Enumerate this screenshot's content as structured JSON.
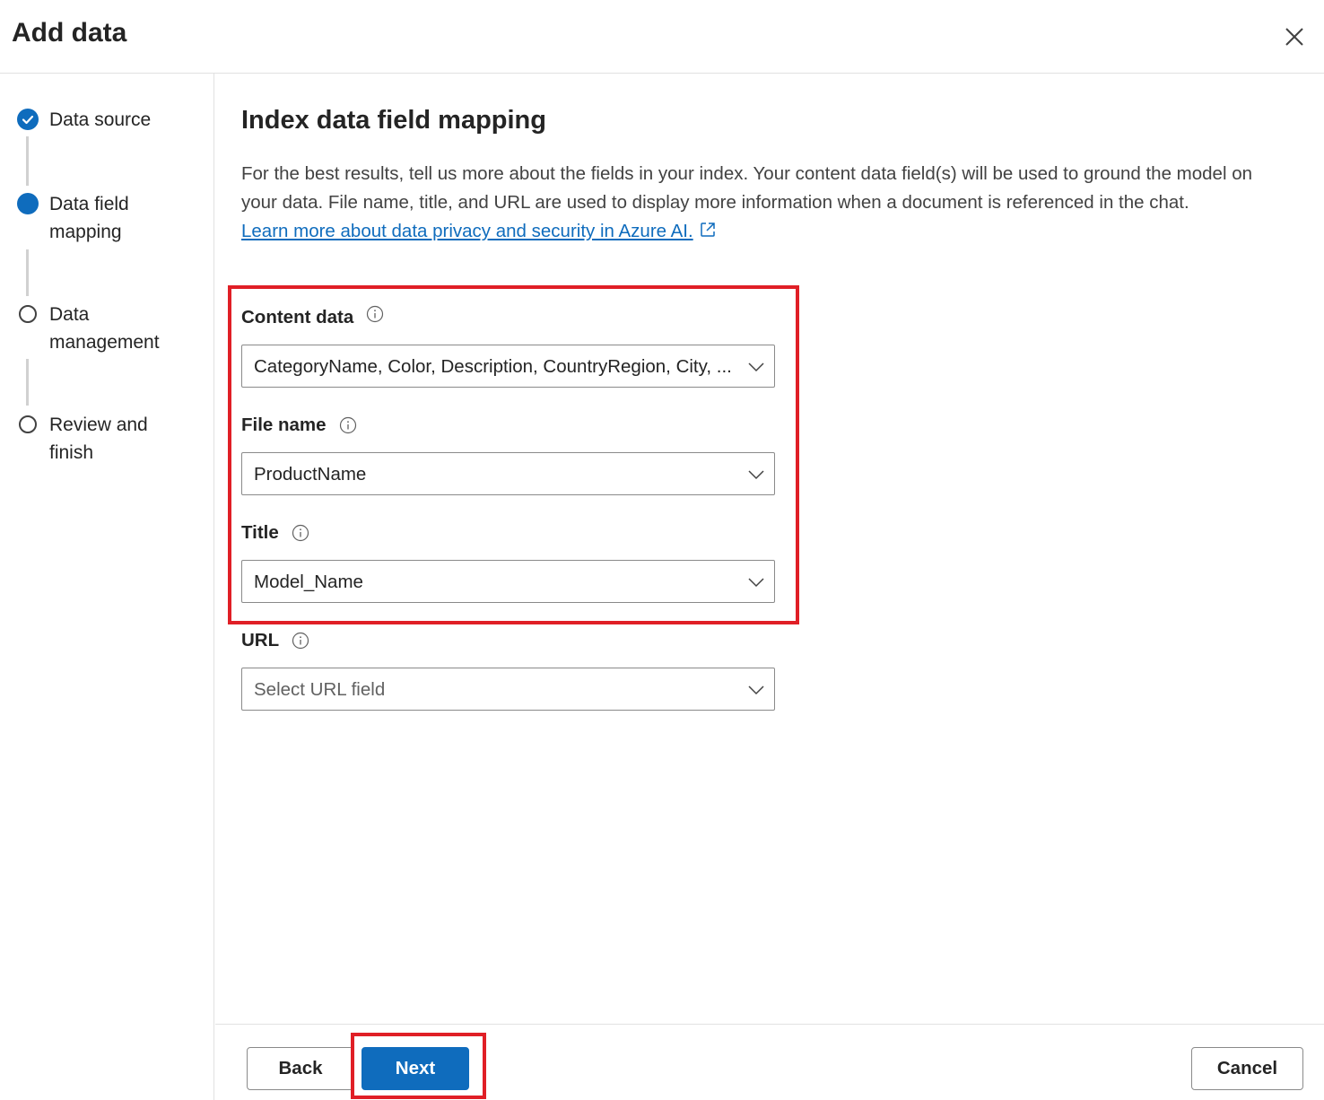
{
  "dialog": {
    "title": "Add data",
    "close_icon": "close-icon"
  },
  "steps": [
    {
      "label": "Data source",
      "state": "done",
      "icon": "checkmark-icon"
    },
    {
      "label": "Data field mapping",
      "state": "current",
      "icon": "filled-circle-icon"
    },
    {
      "label": "Data management",
      "state": "todo",
      "icon": "empty-circle-icon"
    },
    {
      "label": "Review and finish",
      "state": "todo",
      "icon": "empty-circle-icon"
    }
  ],
  "main": {
    "title": "Index data field mapping",
    "description": "For the best results, tell us more about the fields in your index. Your content data field(s) will be used to ground the model on your data. File name, title, and URL are used to display more information when a document is referenced in the chat.",
    "link_text": "Learn more about data privacy and security in Azure AI.",
    "link_icon": "external-link-icon"
  },
  "fields": {
    "content_data": {
      "label": "Content data",
      "value": "CategoryName, Color, Description, CountryRegion, City, ..."
    },
    "file_name": {
      "label": "File name",
      "value": "ProductName"
    },
    "title": {
      "label": "Title",
      "value": "Model_Name"
    },
    "url": {
      "label": "URL",
      "placeholder": "Select URL field"
    }
  },
  "footer": {
    "back_label": "Back",
    "next_label": "Next",
    "cancel_label": "Cancel"
  },
  "colors": {
    "accent": "#0f6cbd",
    "highlight": "#e01f26"
  }
}
